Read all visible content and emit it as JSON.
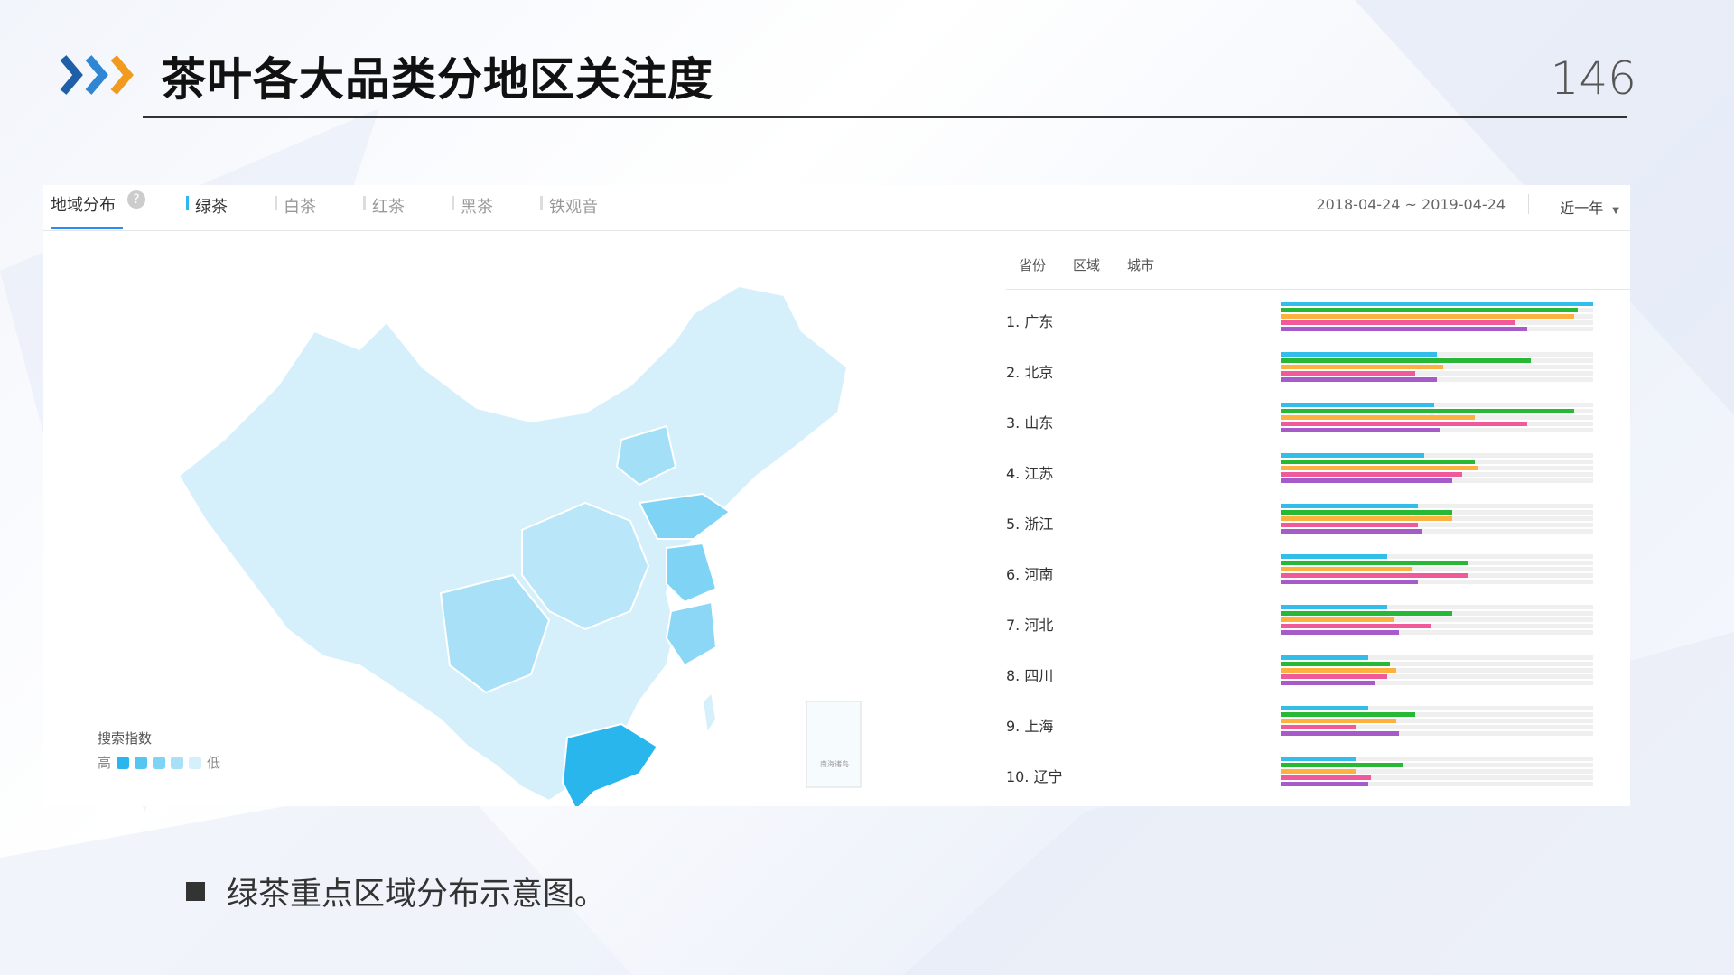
{
  "header": {
    "title": "茶叶各大品类分地区关注度",
    "page_number": "146"
  },
  "panel": {
    "geo_tab": "地域分布",
    "help": "?",
    "tea_tabs": [
      {
        "label": "绿茶",
        "active": true
      },
      {
        "label": "白茶",
        "active": false
      },
      {
        "label": "红茶",
        "active": false
      },
      {
        "label": "黑茶",
        "active": false
      },
      {
        "label": "铁观音",
        "active": false
      }
    ],
    "date_range": "2018-04-24 ~ 2019-04-24",
    "range_select": "近一年"
  },
  "map": {
    "legend_title": "搜索指数",
    "legend_high": "高",
    "legend_low": "低",
    "legend_colors": [
      "#29b6ec",
      "#55c6f0",
      "#7fd3f4",
      "#a8e1f7",
      "#d4f0fb"
    ],
    "inset_label": "南海诸岛"
  },
  "ranking": {
    "tabs": [
      "省份",
      "区域",
      "城市"
    ],
    "bar_colors": [
      "#33bde9",
      "#27b836",
      "#fdb13e",
      "#f0599a",
      "#a65bc8"
    ],
    "rows": [
      {
        "label": "1.  广东",
        "values": [
          1.0,
          0.95,
          0.94,
          0.75,
          0.79
        ]
      },
      {
        "label": "2.  北京",
        "values": [
          0.5,
          0.8,
          0.52,
          0.43,
          0.5
        ]
      },
      {
        "label": "3.  山东",
        "values": [
          0.49,
          0.94,
          0.62,
          0.79,
          0.51
        ]
      },
      {
        "label": "4.  江苏",
        "values": [
          0.46,
          0.62,
          0.63,
          0.58,
          0.55
        ]
      },
      {
        "label": "5.  浙江",
        "values": [
          0.44,
          0.55,
          0.55,
          0.44,
          0.45
        ]
      },
      {
        "label": "6.  河南",
        "values": [
          0.34,
          0.6,
          0.42,
          0.6,
          0.44
        ]
      },
      {
        "label": "7.  河北",
        "values": [
          0.34,
          0.55,
          0.36,
          0.48,
          0.38
        ]
      },
      {
        "label": "8.  四川",
        "values": [
          0.28,
          0.35,
          0.37,
          0.34,
          0.3
        ]
      },
      {
        "label": "9.  上海",
        "values": [
          0.28,
          0.43,
          0.37,
          0.24,
          0.38
        ]
      },
      {
        "label": "10. 辽宁",
        "values": [
          0.24,
          0.39,
          0.24,
          0.29,
          0.28
        ]
      }
    ]
  },
  "caption": "绿茶重点区域分布示意图。"
}
